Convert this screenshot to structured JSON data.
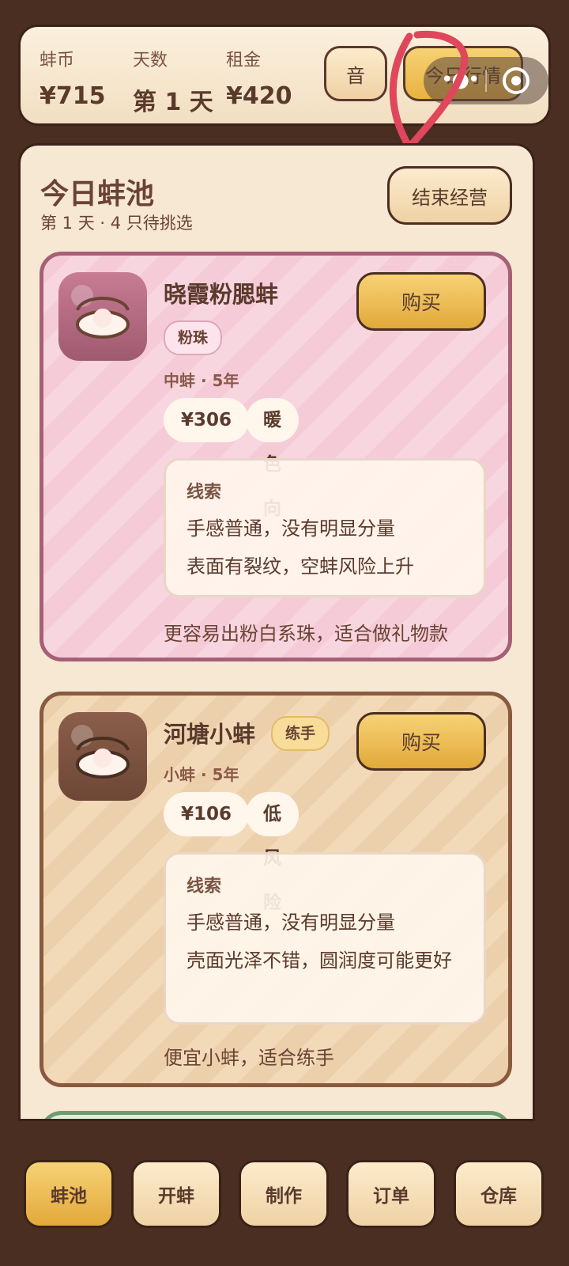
{
  "stats": {
    "coins_label": "蚌币",
    "coins_value": "¥715",
    "days_label": "天数",
    "days_value": "第 1 天",
    "rent_label": "租金",
    "rent_value": "¥420"
  },
  "header_buttons": {
    "sound": "音",
    "market": "今日行情"
  },
  "pool": {
    "title": "今日蚌池",
    "subtitle": "第 1 天 · 4 只待挑选",
    "end_button": "结束经营"
  },
  "clams": [
    {
      "name": "晓霞粉腮蚌",
      "tag": "粉珠",
      "meta": "中蚌 · 5年",
      "price": "¥306",
      "trait": "暖色向",
      "buy_label": "购买",
      "clue_title": "线索",
      "clues": [
        "手感普通，没有明显分量",
        "表面有裂纹，空蚌风险上升"
      ],
      "description": "更容易出粉白系珠，适合做礼物款"
    },
    {
      "name": "河塘小蚌",
      "tag": "练手",
      "meta": "小蚌 · 5年",
      "price": "¥106",
      "trait": "低风险",
      "buy_label": "购买",
      "clue_title": "线索",
      "clues": [
        "手感普通，没有明显分量",
        "壳面光泽不错，圆润度可能更好"
      ],
      "description": "便宜小蚌，适合练手"
    }
  ],
  "tabs": [
    "蚌池",
    "开蚌",
    "制作",
    "订单",
    "仓库"
  ],
  "colors": {
    "accent_gold": "#e8b241",
    "frame_brown": "#4a2e22",
    "pink_card": "#f5cbd8"
  }
}
